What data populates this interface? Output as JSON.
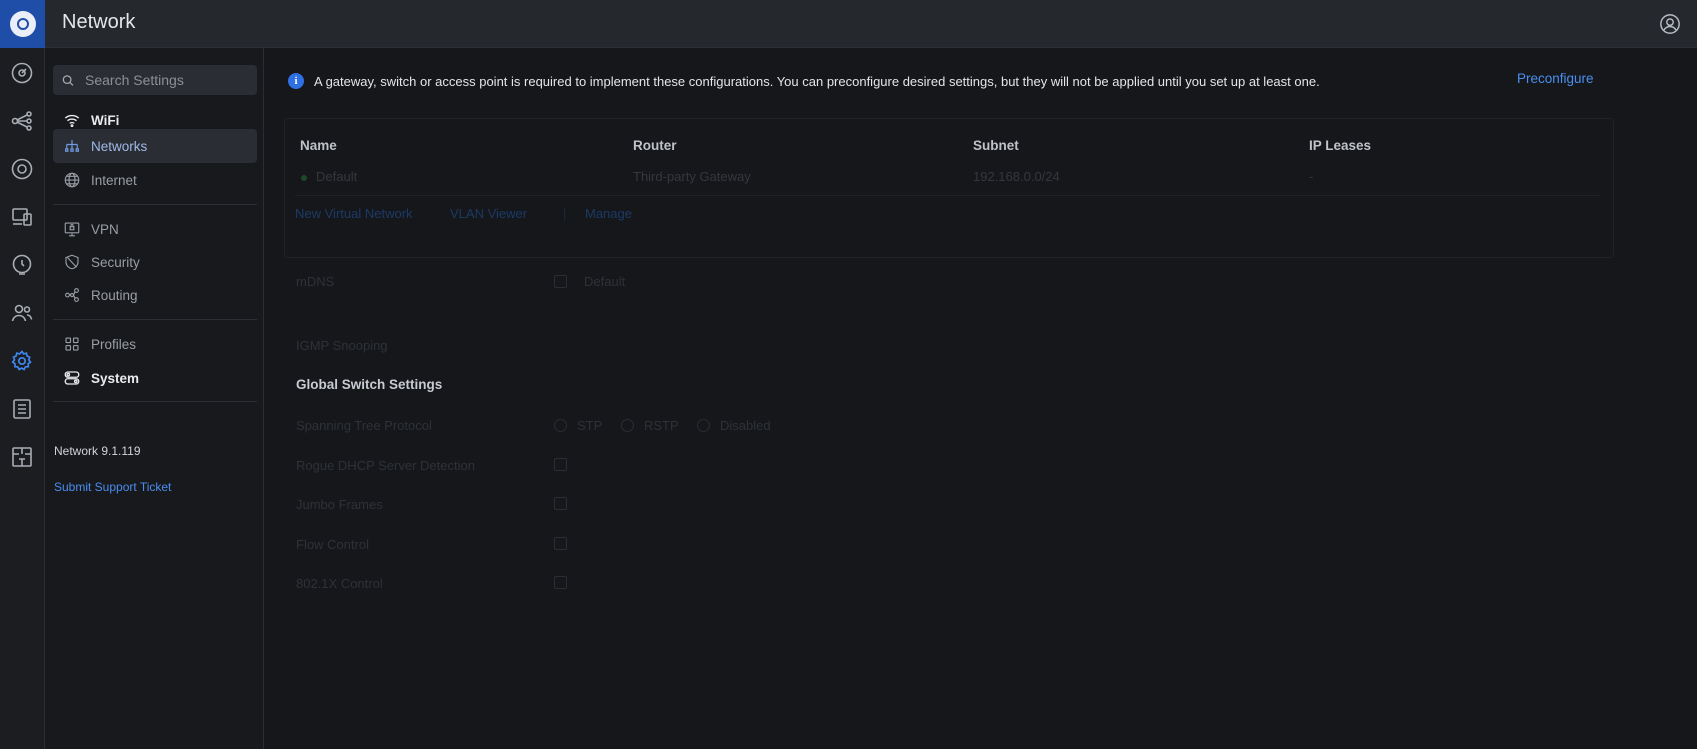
{
  "header": {
    "title": "Network"
  },
  "search": {
    "placeholder": "Search Settings"
  },
  "sidebar": {
    "items": [
      {
        "label": "WiFi"
      },
      {
        "label": "Networks"
      },
      {
        "label": "Internet"
      },
      {
        "label": "VPN"
      },
      {
        "label": "Security"
      },
      {
        "label": "Routing"
      },
      {
        "label": "Profiles"
      },
      {
        "label": "System"
      }
    ],
    "version": "Network 9.1.119",
    "support_link": "Submit Support Ticket"
  },
  "banner": {
    "text": "A gateway, switch or access point is required to implement these configurations. You can preconfigure desired settings, but they will not be applied until you set up at least one.",
    "action": "Preconfigure"
  },
  "networks_table": {
    "columns": [
      "Name",
      "Router",
      "Subnet",
      "IP Leases"
    ],
    "rows": [
      {
        "name": "Default",
        "router": "Third-party Gateway",
        "subnet": "192.168.0.0/24",
        "ip_leases": "-"
      }
    ],
    "links": {
      "new_network": "New Virtual Network",
      "vlan_viewer": "VLAN Viewer",
      "manage": "Manage"
    }
  },
  "settings": {
    "mdns": "mDNS",
    "mdns_option": "Default",
    "igmp": "IGMP Snooping",
    "global_switch_title": "Global Switch Settings",
    "stp": "Spanning Tree Protocol",
    "stp_options": [
      "STP",
      "RSTP",
      "Disabled"
    ],
    "rogue_dhcp": "Rogue DHCP Server Detection",
    "jumbo": "Jumbo Frames",
    "flow": "Flow Control",
    "dot1x": "802.1X Control"
  },
  "colors": {
    "accent": "#4b8ef0",
    "logo_bg": "#1f4ea8",
    "background": "#15171b"
  }
}
